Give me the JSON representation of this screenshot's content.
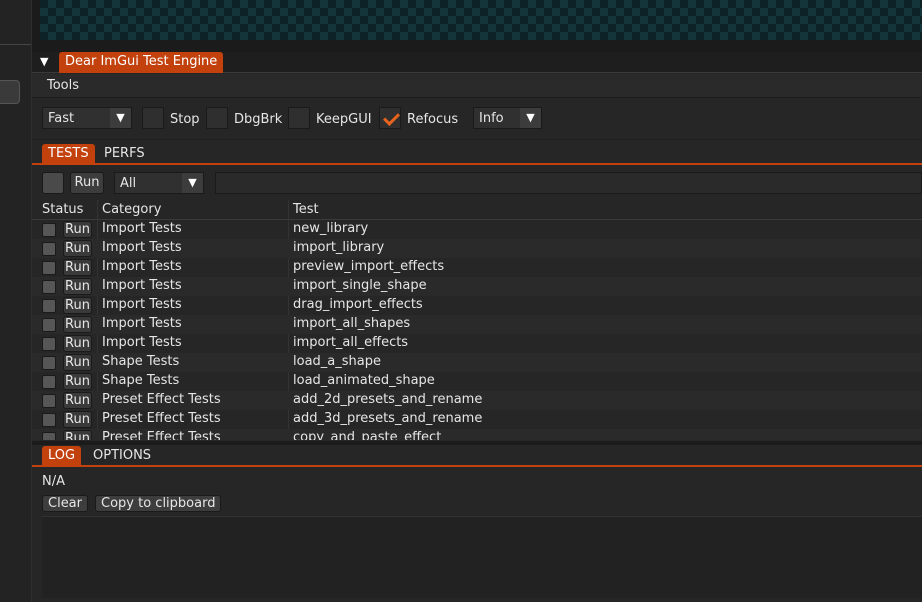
{
  "window": {
    "title": "Dear ImGui Test Engine",
    "collapse_glyph": "▼"
  },
  "menu": {
    "tools_label": "Tools"
  },
  "toolbar": {
    "speed_value": "Fast",
    "verbosity_value": "Info",
    "arrow_glyph": "▼",
    "checkboxes": [
      {
        "label": "Stop",
        "checked": false
      },
      {
        "label": "DbgBrk",
        "checked": false
      },
      {
        "label": "KeepGUI",
        "checked": false
      },
      {
        "label": "Refocus",
        "checked": true
      }
    ]
  },
  "main_tabs": {
    "tests": "TESTS",
    "perfs": "PERFS"
  },
  "filter": {
    "run_label": "Run",
    "group_value": "All",
    "search_value": ""
  },
  "table": {
    "headers": {
      "status": "Status",
      "category": "Category",
      "test": "Test"
    },
    "rows": [
      {
        "run": "Run",
        "category": "Import Tests",
        "test": "new_library"
      },
      {
        "run": "Run",
        "category": "Import Tests",
        "test": "import_library"
      },
      {
        "run": "Run",
        "category": "Import Tests",
        "test": "preview_import_effects"
      },
      {
        "run": "Run",
        "category": "Import Tests",
        "test": "import_single_shape"
      },
      {
        "run": "Run",
        "category": "Import Tests",
        "test": "drag_import_effects"
      },
      {
        "run": "Run",
        "category": "Import Tests",
        "test": "import_all_shapes"
      },
      {
        "run": "Run",
        "category": "Import Tests",
        "test": "import_all_effects"
      },
      {
        "run": "Run",
        "category": "Shape Tests",
        "test": "load_a_shape"
      },
      {
        "run": "Run",
        "category": "Shape Tests",
        "test": "load_animated_shape"
      },
      {
        "run": "Run",
        "category": "Preset Effect Tests",
        "test": "add_2d_presets_and_rename"
      },
      {
        "run": "Run",
        "category": "Preset Effect Tests",
        "test": "add_3d_presets_and_rename"
      },
      {
        "run": "Run",
        "category": "Preset Effect Tests",
        "test": "copy_and_paste_effect"
      }
    ]
  },
  "log_tabs": {
    "log": "LOG",
    "options": "OPTIONS"
  },
  "log": {
    "text": "N/A",
    "clear_label": "Clear",
    "copy_label": "Copy to clipboard"
  }
}
